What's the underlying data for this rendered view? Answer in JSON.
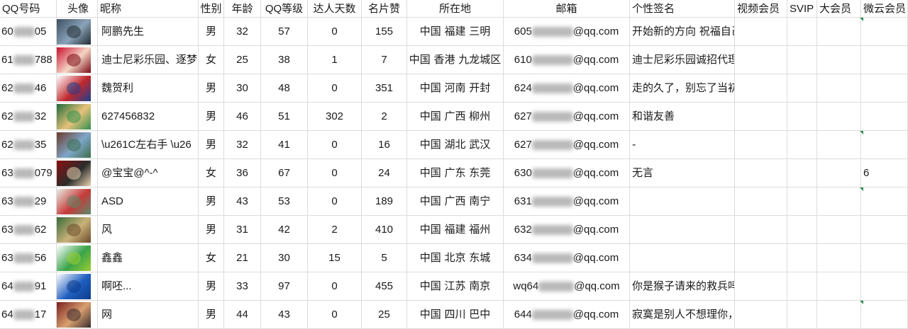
{
  "headers": [
    "QQ号码",
    "头像",
    "昵称",
    "性别",
    "年龄",
    "QQ等级",
    "达人天数",
    "名片赞",
    "所在地",
    "邮箱",
    "个性签名",
    "视频会员",
    "SVIP",
    "大会员",
    "微云会员"
  ],
  "rows": [
    {
      "qq_pre": "60",
      "qq_suf": "05",
      "avatar_icon": "mountain-lake-photo-icon",
      "avatar_colors": [
        "#3d4f63",
        "#8aa3b8",
        "#1f2a33"
      ],
      "nickname": "阿鹏先生",
      "gender": "男",
      "age": "32",
      "qq_level": "57",
      "daren": "0",
      "likes": "155",
      "location": "中国 福建 三明",
      "mail_pre": "605",
      "mail_suf": "@qq.com",
      "signature": "开始新的方向 祝福自己一路顺风",
      "weiyun": ""
    },
    {
      "qq_pre": "61",
      "qq_suf": "788",
      "avatar_icon": "flag-portrait-icon",
      "avatar_colors": [
        "#c8102e",
        "#f5d5c5",
        "#7a0a14"
      ],
      "nickname": "迪士尼彩乐园、逐梦",
      "gender": "女",
      "age": "25",
      "qq_level": "38",
      "daren": "1",
      "likes": "7",
      "location": "中国 香港 九龙城区",
      "mail_pre": "610",
      "mail_suf": "@qq.com",
      "signature": "迪士尼彩乐园诚招代理",
      "weiyun": ""
    },
    {
      "qq_pre": "62",
      "qq_suf": "46",
      "avatar_icon": "logo-icon",
      "avatar_colors": [
        "#ffffff",
        "#c0282d",
        "#1d3f8f"
      ],
      "nickname": "魏贺利",
      "gender": "男",
      "age": "30",
      "qq_level": "48",
      "daren": "0",
      "likes": "351",
      "location": "中国 河南 开封",
      "mail_pre": "624",
      "mail_suf": "@qq.com",
      "signature": "走的久了，别忘了当初为什么出发！",
      "weiyun": ""
    },
    {
      "qq_pre": "62",
      "qq_suf": "32",
      "avatar_icon": "green-sign-icon",
      "avatar_colors": [
        "#1e6b3a",
        "#e8c27a",
        "#2f8f4f"
      ],
      "nickname": "627456832",
      "gender": "男",
      "age": "46",
      "qq_level": "51",
      "daren": "302",
      "likes": "2",
      "location": "中国 广西 柳州",
      "mail_pre": "627",
      "mail_suf": "@qq.com",
      "signature": "和谐友善",
      "weiyun": ""
    },
    {
      "qq_pre": "62",
      "qq_suf": "35",
      "avatar_icon": "waterfall-photo-icon",
      "avatar_colors": [
        "#6b3b2a",
        "#7fa6c9",
        "#3c6e4e"
      ],
      "nickname": "\\u261C左右手 \\u26",
      "gender": "男",
      "age": "32",
      "qq_level": "41",
      "daren": "0",
      "likes": "16",
      "location": "中国 湖北 武汉",
      "mail_pre": "627",
      "mail_suf": "@qq.com",
      "signature": "-",
      "weiyun": ""
    },
    {
      "qq_pre": "63",
      "qq_suf": "079",
      "avatar_icon": "red-poster-icon",
      "avatar_colors": [
        "#8b1010",
        "#2b2b2b",
        "#e9d3b0"
      ],
      "nickname": "@宝宝@^-^",
      "gender": "女",
      "age": "36",
      "qq_level": "67",
      "daren": "0",
      "likes": "24",
      "location": "中国 广东 东莞",
      "mail_pre": "630",
      "mail_suf": "@qq.com",
      "signature": "无言",
      "weiyun": "6"
    },
    {
      "qq_pre": "63",
      "qq_suf": "29",
      "avatar_icon": "blossom-painting-icon",
      "avatar_colors": [
        "#e9efe6",
        "#c63a3a",
        "#5a8a6a"
      ],
      "nickname": " ASD",
      "gender": "男",
      "age": "43",
      "qq_level": "53",
      "daren": "0",
      "likes": "189",
      "location": "中国 广西 南宁",
      "mail_pre": "631",
      "mail_suf": "@qq.com",
      "signature": "",
      "weiyun": ""
    },
    {
      "qq_pre": "63",
      "qq_suf": "62",
      "avatar_icon": "hall-photo-icon",
      "avatar_colors": [
        "#3a6a3a",
        "#c9b27a",
        "#6b4a2a"
      ],
      "nickname": "风",
      "gender": "男",
      "age": "31",
      "qq_level": "42",
      "daren": "2",
      "likes": "410",
      "location": "中国 福建 福州",
      "mail_pre": "632",
      "mail_suf": "@qq.com",
      "signature": "",
      "weiyun": ""
    },
    {
      "qq_pre": "63",
      "qq_suf": "56",
      "avatar_icon": "green-emblem-icon",
      "avatar_colors": [
        "#ffffff",
        "#3aa34a",
        "#9acd32"
      ],
      "nickname": "鑫鑫",
      "gender": "女",
      "age": "21",
      "qq_level": "30",
      "daren": "15",
      "likes": "5",
      "location": "中国 北京 东城",
      "mail_pre": "634",
      "mail_suf": "@qq.com",
      "signature": "",
      "weiyun": ""
    },
    {
      "qq_pre": "64",
      "qq_suf": "91",
      "avatar_icon": "blue-logo-icon",
      "avatar_colors": [
        "#ffffff",
        "#1f5fbf",
        "#0c3c8c"
      ],
      "nickname": "啊呸...",
      "gender": "男",
      "age": "33",
      "qq_level": "97",
      "daren": "0",
      "likes": "455",
      "location": "中国 江苏 南京",
      "mail_pre": "wq64",
      "mail_suf": "@qq.com",
      "signature": "你是猴子请来的救兵吗！",
      "weiyun": ""
    },
    {
      "qq_pre": "64",
      "qq_suf": "17",
      "avatar_icon": "stage-photo-icon",
      "avatar_colors": [
        "#7a1f1f",
        "#d8a070",
        "#3a2a2a"
      ],
      "nickname": "网",
      "gender": "男",
      "age": "44",
      "qq_level": "43",
      "daren": "0",
      "likes": "25",
      "location": "中国 四川 巴中",
      "mail_pre": "644",
      "mail_suf": "@qq.com",
      "signature": "寂寞是别人不想理你，孤独是你不想理别人",
      "weiyun": ""
    }
  ]
}
